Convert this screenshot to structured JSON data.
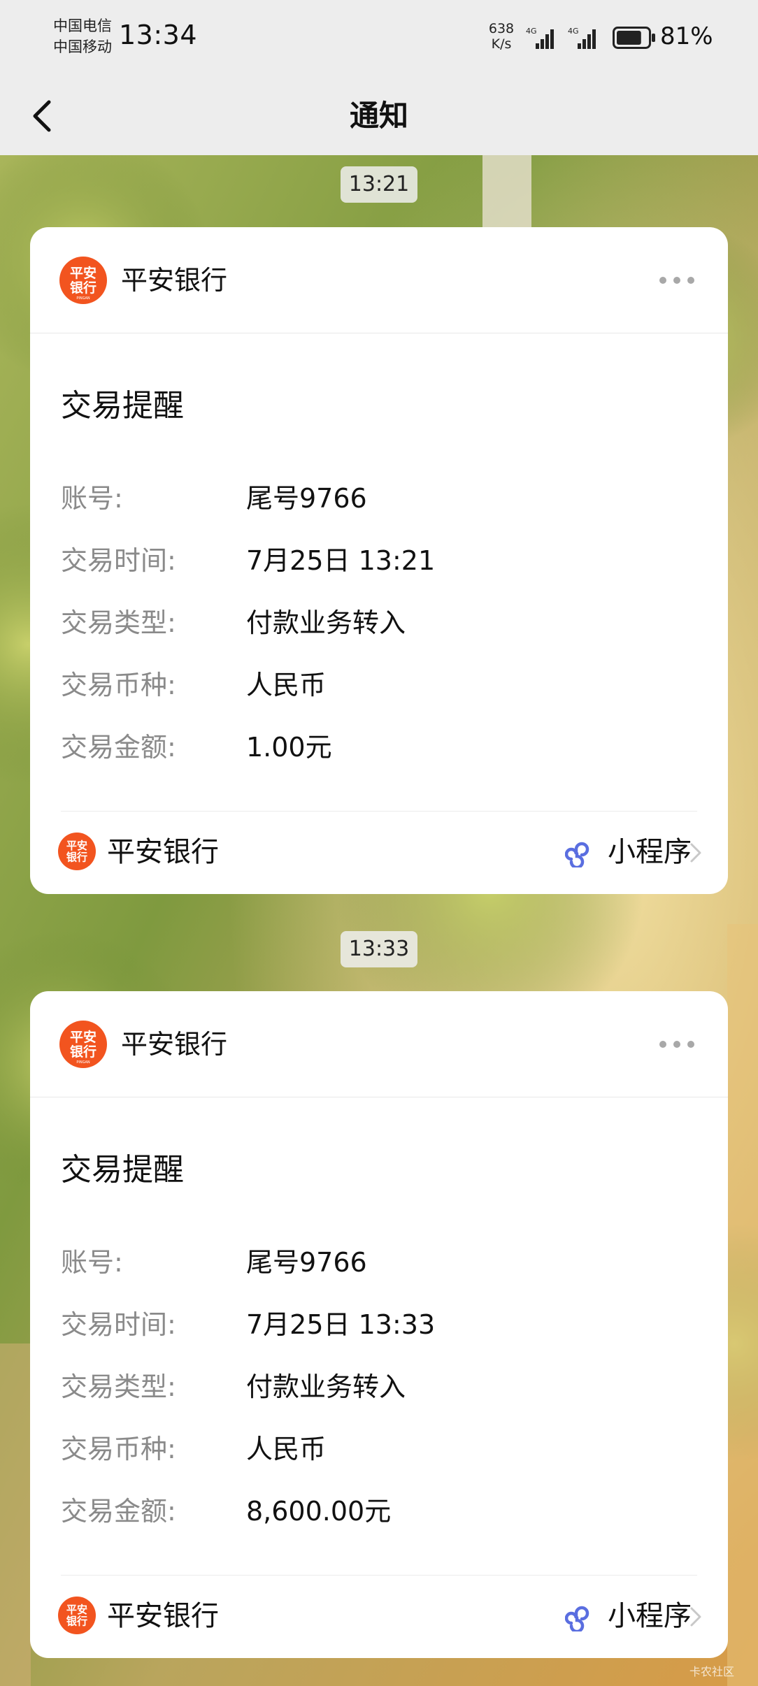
{
  "status_bar": {
    "carrier_1": "中国电信",
    "carrier_2": "中国移动",
    "time": "13:34",
    "net_speed_value": "638",
    "net_speed_unit": "K/s",
    "signal_1_label": "4G",
    "signal_2_label": "4G",
    "battery_percent": "81%",
    "battery_level": 0.81
  },
  "title_bar": {
    "title": "通知",
    "back_icon": "chevron-left-icon"
  },
  "messages": [
    {
      "timestamp": "13:21",
      "sender": "平安银行",
      "logo_text_1": "平安",
      "logo_text_2": "银行",
      "logo_text_3": "PINGAN",
      "title": "交易提醒",
      "rows": [
        {
          "label": "账号:",
          "value": "尾号9766"
        },
        {
          "label": "交易时间:",
          "value": "7月25日 13:21"
        },
        {
          "label": "交易类型:",
          "value": "付款业务转入"
        },
        {
          "label": "交易币种:",
          "value": "人民币"
        },
        {
          "label": "交易金额:",
          "value": "1.00元"
        }
      ],
      "footer_name": "平安银行",
      "mini_program_label": "小程序"
    },
    {
      "timestamp": "13:33",
      "sender": "平安银行",
      "logo_text_1": "平安",
      "logo_text_2": "银行",
      "logo_text_3": "PINGAN",
      "title": "交易提醒",
      "rows": [
        {
          "label": "账号:",
          "value": "尾号9766"
        },
        {
          "label": "交易时间:",
          "value": "7月25日 13:33"
        },
        {
          "label": "交易类型:",
          "value": "付款业务转入"
        },
        {
          "label": "交易币种:",
          "value": "人民币"
        },
        {
          "label": "交易金额:",
          "value": "8,600.00元"
        }
      ],
      "footer_name": "平安银行",
      "mini_program_label": "小程序"
    }
  ],
  "watermark": "卡农社区",
  "colors": {
    "brand_orange": "#f2541f",
    "mini_program_blue": "#5a6ee0",
    "label_gray": "#8a8a8a",
    "bar_gray": "#ededed"
  }
}
